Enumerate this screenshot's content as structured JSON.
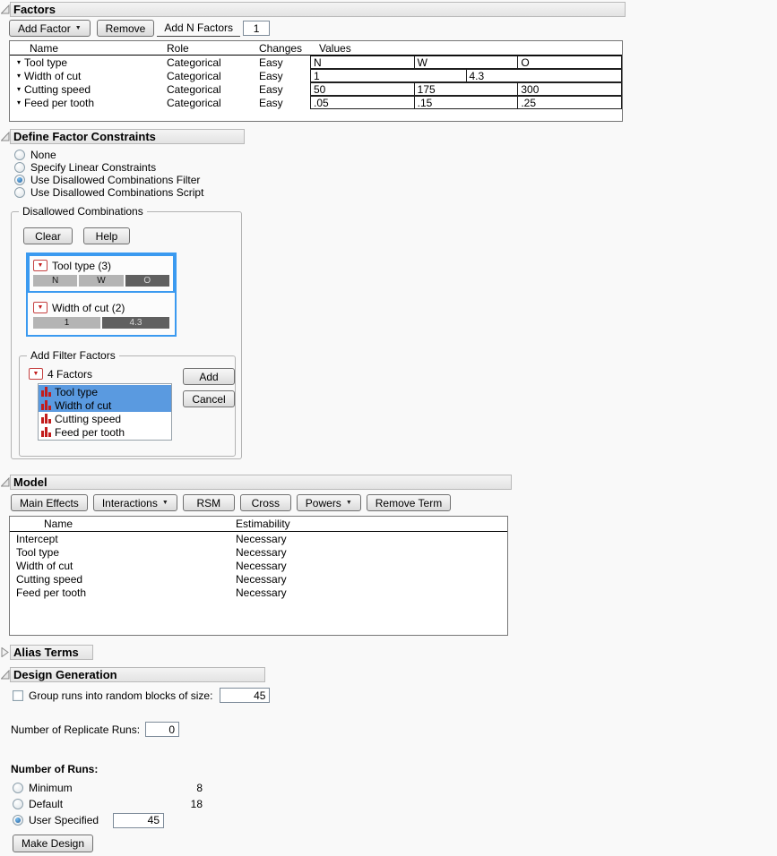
{
  "icons": {
    "dropdown_arrow": "▼",
    "row_expand": "▾",
    "filter_menu": "▼"
  },
  "colors": {
    "accent_blue": "#3b9af0",
    "selection_blue": "#5a9ae0",
    "seg_light": "#b4b4b4",
    "seg_dark": "#606060",
    "icon_red": "#c21d1d"
  },
  "factors": {
    "title": "Factors",
    "toolbar": {
      "add_factor": "Add Factor",
      "remove": "Remove",
      "add_n_factors": "Add N Factors",
      "n_value": "1"
    },
    "columns": {
      "name": "Name",
      "role": "Role",
      "changes": "Changes",
      "values": "Values"
    },
    "rows": [
      {
        "name": "Tool type",
        "role": "Categorical",
        "changes": "Easy",
        "values": [
          "N",
          "W",
          "O"
        ]
      },
      {
        "name": "Width of cut",
        "role": "Categorical",
        "changes": "Easy",
        "values": [
          "1",
          "4.3"
        ]
      },
      {
        "name": "Cutting speed",
        "role": "Categorical",
        "changes": "Easy",
        "values": [
          "50",
          "175",
          "300"
        ]
      },
      {
        "name": "Feed per tooth",
        "role": "Categorical",
        "changes": "Easy",
        "values": [
          ".05",
          ".15",
          ".25"
        ]
      }
    ]
  },
  "constraints": {
    "title": "Define Factor Constraints",
    "options": [
      {
        "label": "None",
        "selected": false
      },
      {
        "label": "Specify Linear Constraints",
        "selected": false
      },
      {
        "label": "Use Disallowed Combinations Filter",
        "selected": true
      },
      {
        "label": "Use Disallowed Combinations Script",
        "selected": false
      }
    ],
    "disallowed": {
      "title": "Disallowed Combinations",
      "clear": "Clear",
      "help": "Help",
      "filters": [
        {
          "label": "Tool type (3)",
          "segments": [
            {
              "label": "N",
              "selected": false
            },
            {
              "label": "W",
              "selected": false
            },
            {
              "label": "O",
              "selected": true
            }
          ]
        },
        {
          "label": "Width of cut (2)",
          "segments": [
            {
              "label": "1",
              "selected": false
            },
            {
              "label": "4.3",
              "selected": true
            }
          ]
        }
      ],
      "add_filter": {
        "title": "Add Filter Factors",
        "header": "4 Factors",
        "items": [
          {
            "label": "Tool type",
            "selected": true
          },
          {
            "label": "Width of cut",
            "selected": true
          },
          {
            "label": "Cutting speed",
            "selected": false
          },
          {
            "label": "Feed per tooth",
            "selected": false
          }
        ],
        "add": "Add",
        "cancel": "Cancel"
      }
    }
  },
  "model": {
    "title": "Model",
    "buttons": {
      "main_effects": "Main Effects",
      "interactions": "Interactions",
      "rsm": "RSM",
      "cross": "Cross",
      "powers": "Powers",
      "remove_term": "Remove Term"
    },
    "columns": {
      "name": "Name",
      "estimability": "Estimability"
    },
    "rows": [
      {
        "name": "Intercept",
        "estimability": "Necessary"
      },
      {
        "name": "Tool type",
        "estimability": "Necessary"
      },
      {
        "name": "Width of cut",
        "estimability": "Necessary"
      },
      {
        "name": "Cutting speed",
        "estimability": "Necessary"
      },
      {
        "name": "Feed per tooth",
        "estimability": "Necessary"
      }
    ]
  },
  "alias": {
    "title": "Alias Terms"
  },
  "design_generation": {
    "title": "Design Generation",
    "group_label": "Group runs into random blocks of size:",
    "group_value": "45",
    "replicate_label": "Number of Replicate Runs:",
    "replicate_value": "0"
  },
  "runs": {
    "title": "Number of Runs:",
    "options": [
      {
        "label": "Minimum",
        "value": "8",
        "selected": false
      },
      {
        "label": "Default",
        "value": "18",
        "selected": false
      },
      {
        "label": "User Specified",
        "value": "45",
        "selected": true
      }
    ],
    "make_design": "Make Design"
  }
}
